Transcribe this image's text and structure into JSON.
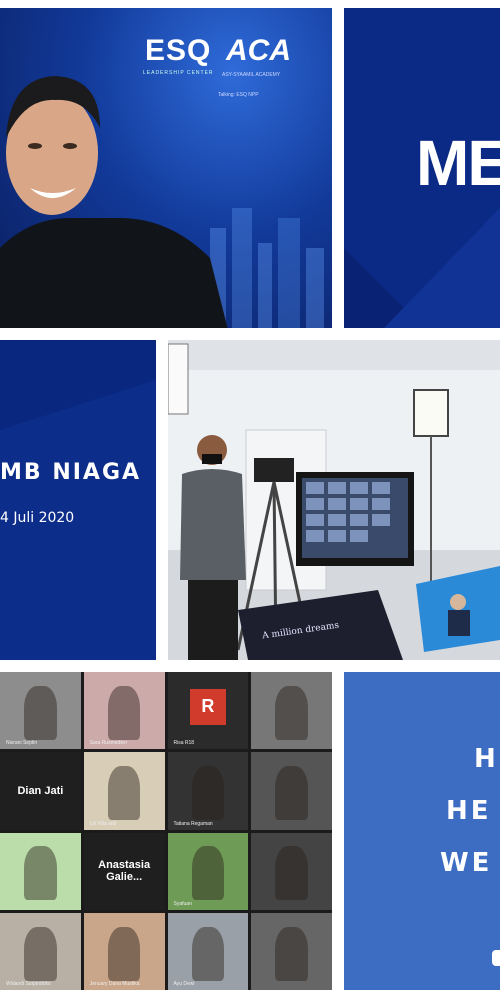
{
  "panel1": {
    "logo_esq": "ESQ",
    "logo_esq_sub": "LEADERSHIP CENTER",
    "logo_aca": "ACA",
    "logo_aca_sub": "ASY-SYAAMIL ACADEMY",
    "caption": "Talking: ESQ NPP"
  },
  "panel2": {
    "title": "ME"
  },
  "panel3": {
    "company": "MB NIAGA",
    "date": "4 Juli 2020"
  },
  "panel4": {
    "banner_text": "A million dreams"
  },
  "panel5": {
    "tiles": [
      {
        "name": "Nisrani Septin"
      },
      {
        "name": "Sara Rusmedien"
      },
      {
        "name": "Risa R18",
        "avatar": "R"
      },
      {
        "name": ""
      },
      {
        "name": "Dian Jati",
        "center": true
      },
      {
        "name": "Lili Villa ardi"
      },
      {
        "name": "Tatiana Regaman"
      },
      {
        "name": ""
      },
      {
        "name": ""
      },
      {
        "name": "Anastasia Galie...",
        "center": true
      },
      {
        "name": "Syafuan"
      },
      {
        "name": ""
      },
      {
        "name": "Widandi Surjandoko"
      },
      {
        "name": "Jenuary Dana Mustika"
      },
      {
        "name": "Ayu Dewi"
      },
      {
        "name": ""
      }
    ]
  },
  "panel6": {
    "lines": [
      "H",
      "HE",
      "WE"
    ]
  },
  "colors": {
    "navy": "#0b2a86",
    "zoom_bg": "#1b1b1b",
    "accent_blue": "#3d6dc2",
    "avatar_red": "#d13b2b"
  }
}
